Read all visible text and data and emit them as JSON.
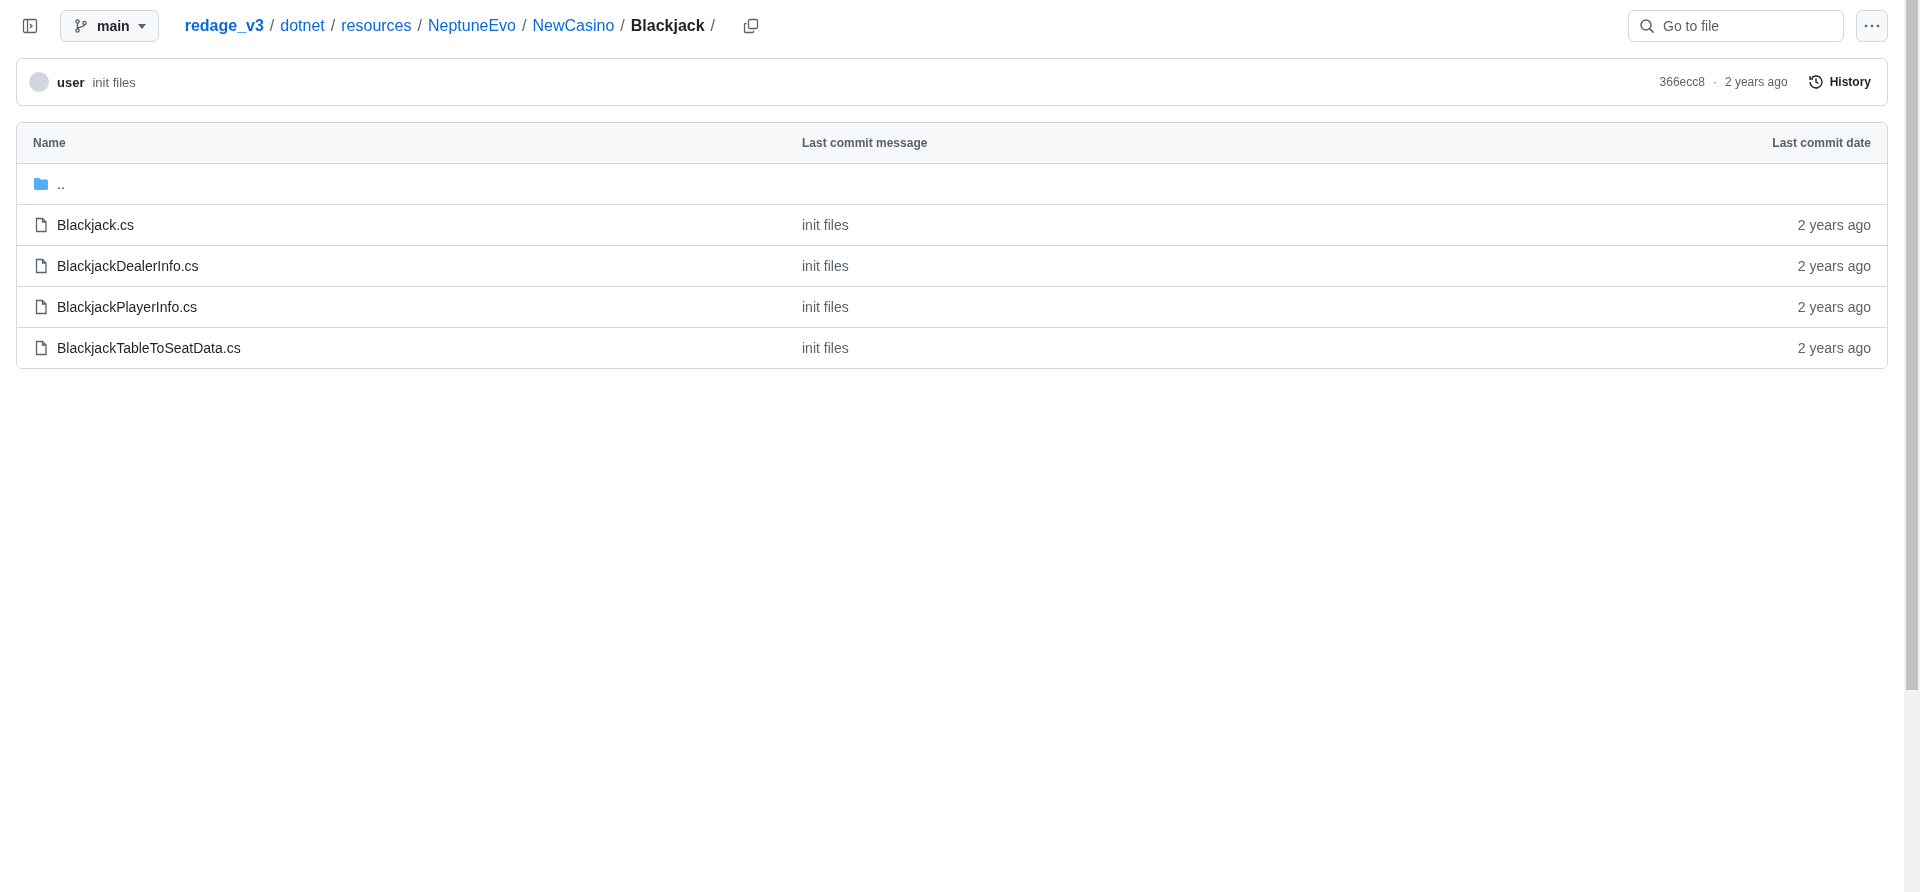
{
  "header": {
    "branch": "main",
    "breadcrumb": [
      {
        "label": "redage_v3",
        "kind": "repo"
      },
      {
        "label": "dotnet",
        "kind": "link"
      },
      {
        "label": "resources",
        "kind": "link"
      },
      {
        "label": "NeptuneEvo",
        "kind": "link"
      },
      {
        "label": "NewCasino",
        "kind": "link"
      },
      {
        "label": "Blackjack",
        "kind": "current"
      }
    ],
    "separator": "/",
    "search": {
      "placeholder": "Go to file"
    }
  },
  "commit": {
    "author": "user",
    "message": "init files",
    "hash": "366ecc8",
    "meta_separator": "·",
    "date": "2 years ago",
    "history": "History"
  },
  "table": {
    "columns": [
      "Name",
      "Last commit message",
      "Last commit date"
    ],
    "rows": [
      {
        "kind": "folder",
        "name": ".."
      },
      {
        "kind": "file",
        "name": "Blackjack.cs",
        "message": "init files",
        "date": "2 years ago"
      },
      {
        "kind": "file",
        "name": "BlackjackDealerInfo.cs",
        "message": "init files",
        "date": "2 years ago"
      },
      {
        "kind": "file",
        "name": "BlackjackPlayerInfo.cs",
        "message": "init files",
        "date": "2 years ago"
      },
      {
        "kind": "file",
        "name": "BlackjackTableToSeatData.cs",
        "message": "init files",
        "date": "2 years ago"
      }
    ]
  }
}
